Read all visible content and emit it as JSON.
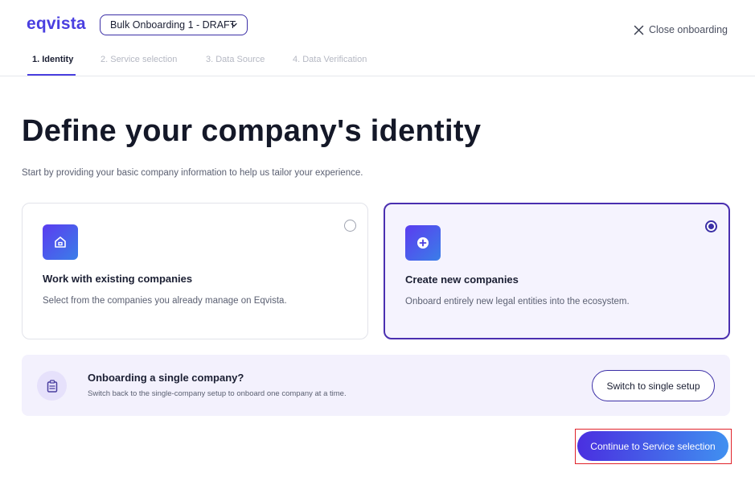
{
  "header": {
    "logo": "eqvista",
    "draft_select": "Bulk Onboarding 1 - DRAFT",
    "close_label": "Close onboarding"
  },
  "tabs": [
    {
      "label": "1. Identity",
      "active": true
    },
    {
      "label": "2. Service selection",
      "active": false
    },
    {
      "label": "3. Data Source",
      "active": false
    },
    {
      "label": "4. Data Verification",
      "active": false
    }
  ],
  "main": {
    "title": "Define your company's identity",
    "subtitle": "Start by providing your basic company information to help us tailor your experience."
  },
  "options": [
    {
      "title": "Work with existing companies",
      "description": "Select from the companies you already manage on Eqvista.",
      "icon": "home-icon",
      "selected": false
    },
    {
      "title": "Create new companies",
      "description": "Onboard entirely new legal entities into the ecosystem.",
      "icon": "plus-circle-icon",
      "selected": true
    }
  ],
  "banner": {
    "title": "Onboarding a single company?",
    "description": "Switch back to the single-company setup to onboard one company at a time.",
    "button": "Switch to single setup",
    "icon": "clipboard-icon"
  },
  "footer": {
    "continue_label": "Continue to Service selection"
  },
  "colors": {
    "accent": "#4a3fe0",
    "selected_border": "#4a2fb0",
    "highlight_box": "#e0222a"
  }
}
